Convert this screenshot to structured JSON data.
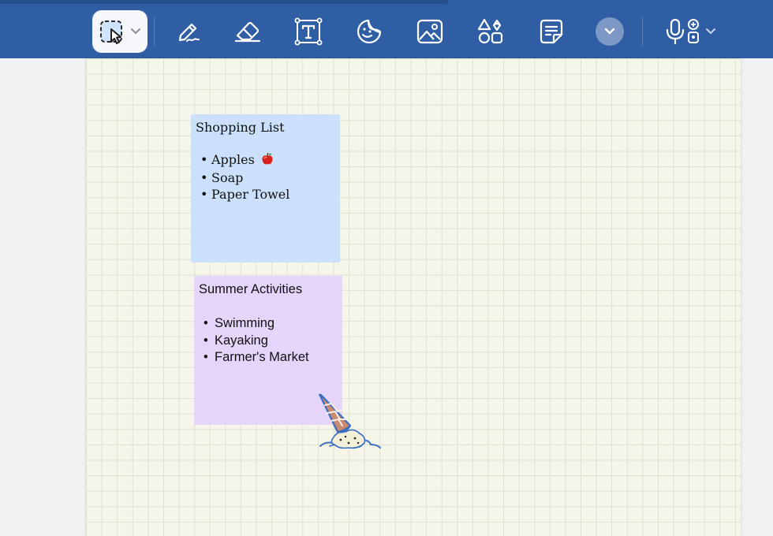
{
  "toolbar": {
    "colors": {
      "bar": "#2f5ea5",
      "selected_bg": "#f5f7fb",
      "icon": "#ffffff"
    },
    "tools": [
      {
        "name": "lasso-select-tool",
        "icon": "lasso-select-icon",
        "selected": true
      },
      {
        "name": "pen-tool",
        "icon": "pen-icon"
      },
      {
        "name": "eraser-tool",
        "icon": "eraser-icon"
      },
      {
        "name": "text-box-tool",
        "icon": "text-box-icon"
      },
      {
        "name": "sticker-tool",
        "icon": "sticker-icon"
      },
      {
        "name": "image-tool",
        "icon": "image-icon"
      },
      {
        "name": "shapes-tool",
        "icon": "shapes-icon"
      },
      {
        "name": "sticky-note-tool",
        "icon": "sticky-note-icon"
      },
      {
        "name": "more-tools-button",
        "icon": "chevron-down-icon"
      },
      {
        "name": "dictation-tool",
        "icon": "microphone-icon"
      }
    ]
  },
  "notes": {
    "shopping": {
      "title": "Shopping List",
      "items": [
        "Apples",
        "Soap",
        "Paper Towel"
      ],
      "item_emoji": "apple-icon",
      "color": "#cbe1fb"
    },
    "summer": {
      "title": "Summer Activities",
      "items": [
        "Swimming",
        "Kayaking",
        "Farmer's Market"
      ],
      "color": "#e6d5fb"
    }
  },
  "bullet": "•",
  "canvas": {
    "paper_color": "#f5f5ea",
    "grid_color": "#dfe0d2"
  },
  "sticker": {
    "name": "melted-ice-cream-sticker"
  }
}
